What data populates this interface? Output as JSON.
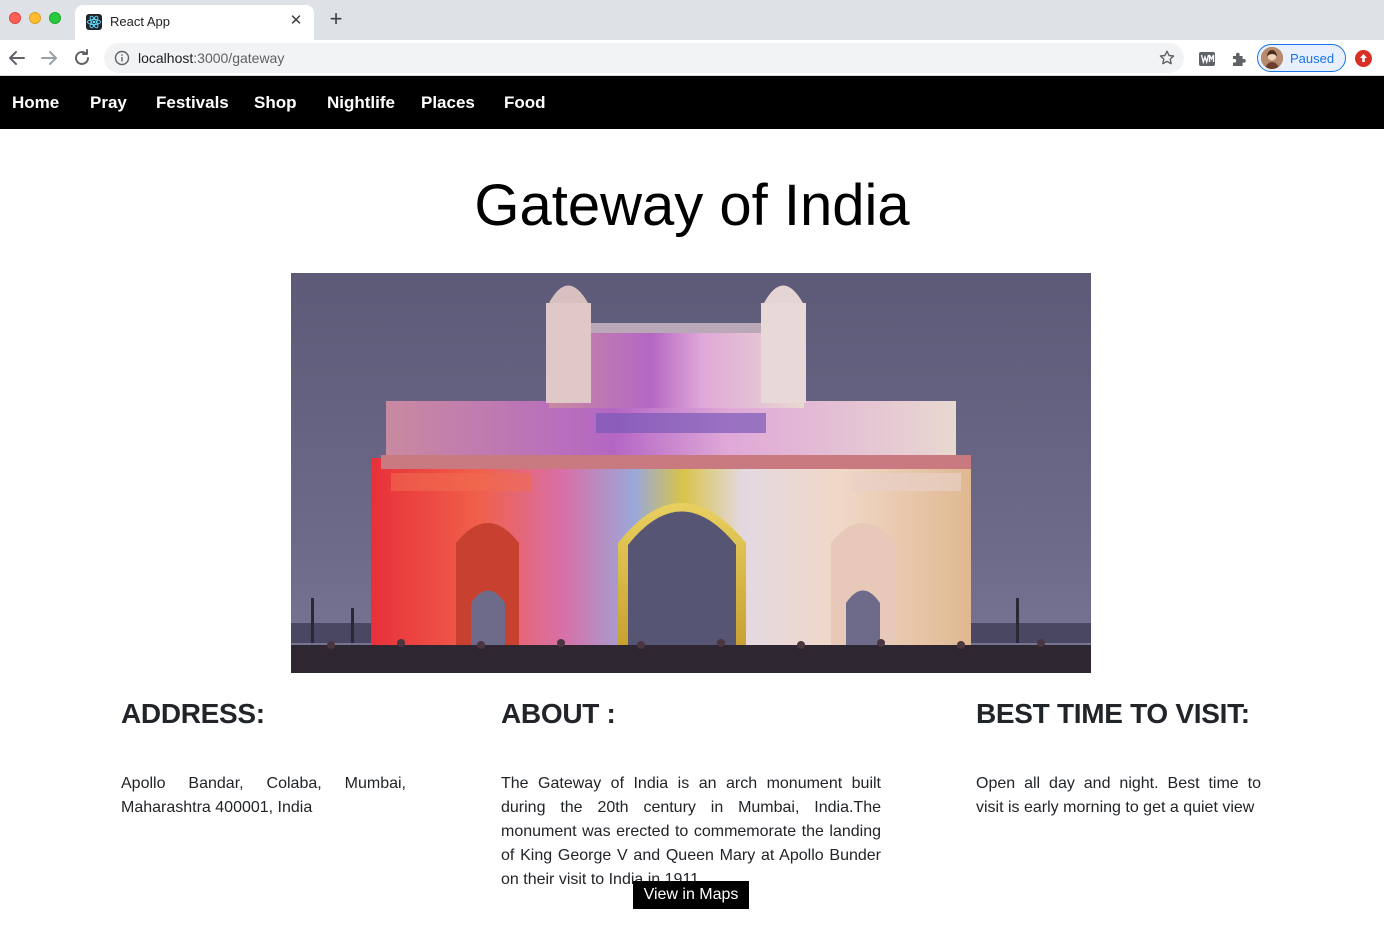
{
  "browser": {
    "tab_title": "React App",
    "url_host": "localhost",
    "url_path": ":3000/gateway",
    "profile_label": "Paused"
  },
  "nav": {
    "items": [
      "Home",
      "Pray",
      "Festivals",
      "Shop",
      "Nightlife",
      "Places",
      "Food"
    ]
  },
  "page": {
    "title": "Gateway of India",
    "address": {
      "heading": "ADDRESS:",
      "text": "Apollo Bandar, Colaba, Mumbai, Maharashtra 400001, India"
    },
    "about": {
      "heading": "ABOUT :",
      "text": "The Gateway of India is an arch monument built during the 20th century in Mumbai, India.The monument was erected to commemorate the landing of King George V and Queen Mary at Apollo Bunder on their visit to India in 1911."
    },
    "best_time": {
      "heading": "BEST TIME TO VISIT:",
      "text": "Open all day and night. Best time to visit is early morning to get a quiet view"
    },
    "maps_button": "View in Maps"
  },
  "colors": {
    "nav_background": "#000000",
    "nav_text": "#ffffff",
    "heading_text": "#212529",
    "button_background": "#000000",
    "profile_accent": "#1a73e8"
  },
  "icons": {
    "tab_favicon": "react-logo-icon",
    "back": "arrow-left-icon",
    "forward": "arrow-right-icon",
    "reload": "reload-icon",
    "site_info": "info-icon",
    "bookmark": "star-icon",
    "extension_1": "wm-extension-icon",
    "extensions": "puzzle-icon",
    "update": "update-icon"
  }
}
